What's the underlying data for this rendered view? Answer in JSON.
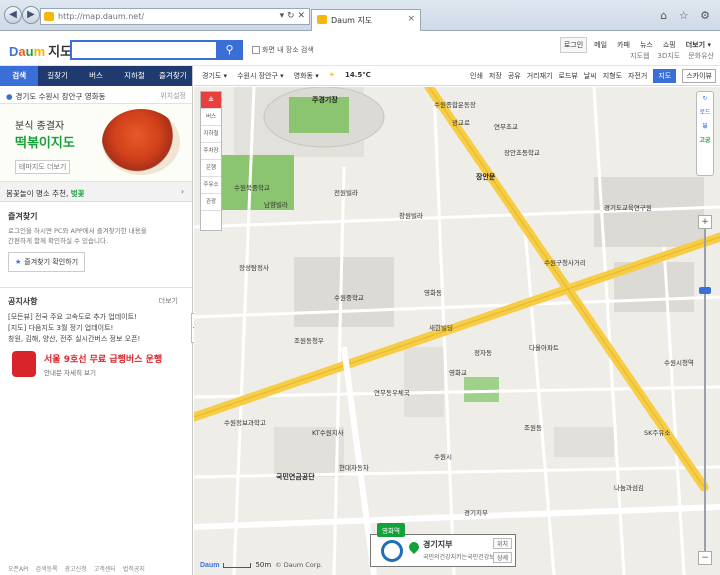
{
  "browser": {
    "url": "http://map.daum.net/",
    "tab_title": "Daum 지도",
    "tab_close": "×",
    "back": "◀",
    "forward": "▶",
    "addr_tools": "▾ ↻ ✕",
    "icons": "⌂ ☆ ⚙"
  },
  "header": {
    "logo": [
      "D",
      "a",
      "u",
      "m"
    ],
    "service": "지도",
    "search_placeholder": "",
    "search_icon": "⚲",
    "checkbox_label": "화면 내 장소 검색",
    "top_links": [
      "로그인",
      "메일",
      "카페",
      "뉴스",
      "쇼핑",
      "더보기 ▾"
    ],
    "sub_links": [
      "지도웹",
      "3D지도",
      "문화유산"
    ]
  },
  "left": {
    "tabs": [
      "검색",
      "길찾기",
      "버스",
      "지하철",
      "즐겨찾기"
    ],
    "location": "경기도 수원시 장안구 영화동",
    "location_reset": "위치설정",
    "banner": {
      "line1": "분식 종결자",
      "line2": "떡볶이지도",
      "button": "테마지도 더보기"
    },
    "recommend": {
      "prefix": "봄꽃놀이 명소 추천, ",
      "highlight": "벚꽃",
      "arrow": "›"
    },
    "favorites": {
      "title": "즐겨찾기",
      "desc1": "로그인을 하시면 PC와 APP에서 즐겨찾기한 내용을",
      "desc2": "간편하게 함께 확인하실 수 있습니다.",
      "button": "즐겨찾기 확인하기",
      "star": "★"
    },
    "notice": {
      "title": "공지사항",
      "more": "더보기",
      "lines": [
        "[모든뷰] 전국 주요 고속도로 추가 업데이트!",
        "[지도] 다음지도 3월 정기 업데이트!",
        "창원, 김해, 양산, 전주 실시간버스 정보 오픈!"
      ]
    },
    "busad": {
      "title": "서울 9호선 무료 급행버스 운행",
      "sub": "안내문 자세히 보기"
    },
    "footer": [
      "오픈API",
      "검색등록",
      "광고신청",
      "고객센터",
      "법적공지"
    ],
    "collapse": "◀"
  },
  "maptool": {
    "breadcrumb": [
      "경기도 ▾",
      "수원시 장안구 ▾",
      "영화동 ▾"
    ],
    "weather_icon": "☀",
    "temperature": "14.5℃",
    "tools": [
      "인쇄",
      "저장",
      "공유",
      "거리재기",
      "로드뷰",
      "날씨",
      "지형도",
      "자전거"
    ],
    "map_type": "지도",
    "sky": "스카이뷰"
  },
  "map": {
    "side_tools": [
      "쇼",
      "버스",
      "지하철",
      "주차장",
      "은행",
      "주유소",
      "관광"
    ],
    "controls": [
      "↻",
      "로드뷰",
      "⌂",
      "고궁"
    ],
    "zoom_plus": "+",
    "zoom_minus": "−",
    "scale_logo": "Daum",
    "scale_text": "50m",
    "copyright": "© Daum Corp.",
    "labels": [
      "수원종합운동장",
      "주경기장",
      "연무초교",
      "연무동우체국",
      "수원북중학교",
      "전원빌라",
      "창원빌라",
      "남향빌라",
      "광교로",
      "장안문",
      "장안초등학교",
      "경기도교육연구원",
      "수원구청사거리",
      "수원시청역",
      "다올아파트",
      "영화동",
      "수원중학교",
      "새한빌딩",
      "정자동",
      "영화교",
      "국민연금공단",
      "현대자동차",
      "KT수원지사",
      "수원정보과학고",
      "SK주유소",
      "나눔과섬김",
      "장성탐정사",
      "수원시",
      "조원동",
      "조원동청우",
      "경기지부"
    ],
    "popup": {
      "station": "영화역",
      "name": "경기지부",
      "desc": "국민의건강지키는국민건강보험",
      "b1": "위치",
      "b2": "상세"
    }
  }
}
